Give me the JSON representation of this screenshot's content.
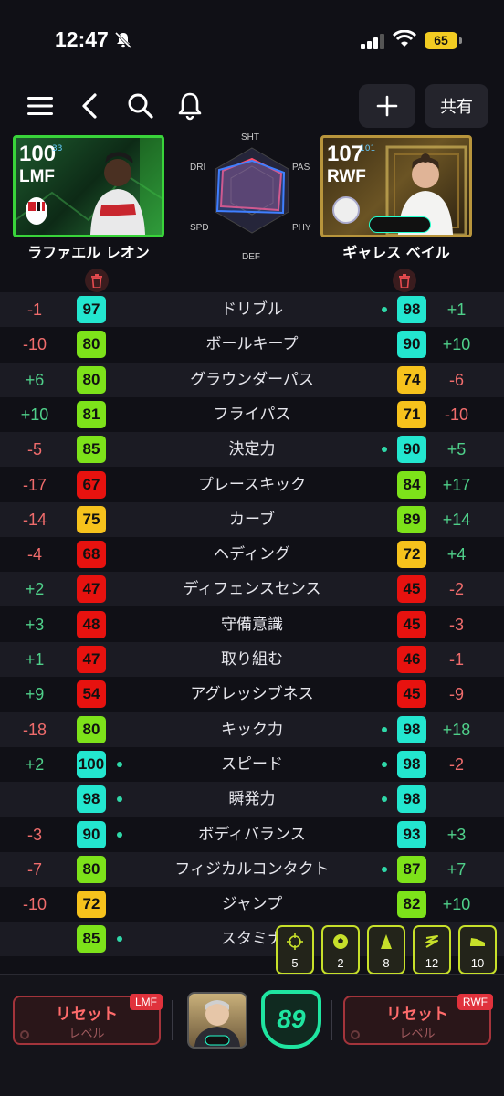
{
  "status_bar": {
    "time": "12:47",
    "battery": "65"
  },
  "toolbar": {
    "share_label": "共有"
  },
  "player_left": {
    "rating": "100",
    "position": "LMF",
    "small_text": "33",
    "name": "ラファエル レオン"
  },
  "player_right": {
    "rating": "107",
    "position": "RWF",
    "small_text": "101",
    "name": "ギャレス ベイル"
  },
  "radar": {
    "labels": [
      "SHT",
      "PAS",
      "PHY",
      "DEF",
      "SPD",
      "DRI"
    ]
  },
  "colors": {
    "cyan": "#23e6cf",
    "green": "#7de21a",
    "yellow": "#f6c21c",
    "red": "#e7120f",
    "diff_pos": "#4fd08a",
    "diff_neg": "#f06c6c"
  },
  "stats": [
    {
      "name": "ドリブル",
      "left_diff": "-1",
      "left": "97",
      "left_color": "cyan",
      "left_dot": false,
      "right": "98",
      "right_color": "cyan",
      "right_dot": true,
      "right_diff": "+1"
    },
    {
      "name": "ボールキープ",
      "left_diff": "-10",
      "left": "80",
      "left_color": "green",
      "left_dot": false,
      "right": "90",
      "right_color": "cyan",
      "right_dot": false,
      "right_diff": "+10"
    },
    {
      "name": "グラウンダーパス",
      "left_diff": "+6",
      "left": "80",
      "left_color": "green",
      "left_dot": false,
      "right": "74",
      "right_color": "yellow",
      "right_dot": false,
      "right_diff": "-6"
    },
    {
      "name": "フライパス",
      "left_diff": "+10",
      "left": "81",
      "left_color": "green",
      "left_dot": false,
      "right": "71",
      "right_color": "yellow",
      "right_dot": false,
      "right_diff": "-10"
    },
    {
      "name": "決定力",
      "left_diff": "-5",
      "left": "85",
      "left_color": "green",
      "left_dot": false,
      "right": "90",
      "right_color": "cyan",
      "right_dot": true,
      "right_diff": "+5"
    },
    {
      "name": "プレースキック",
      "left_diff": "-17",
      "left": "67",
      "left_color": "red",
      "left_dot": false,
      "right": "84",
      "right_color": "green",
      "right_dot": false,
      "right_diff": "+17"
    },
    {
      "name": "カーブ",
      "left_diff": "-14",
      "left": "75",
      "left_color": "yellow",
      "left_dot": false,
      "right": "89",
      "right_color": "green",
      "right_dot": false,
      "right_diff": "+14"
    },
    {
      "name": "ヘディング",
      "left_diff": "-4",
      "left": "68",
      "left_color": "red",
      "left_dot": false,
      "right": "72",
      "right_color": "yellow",
      "right_dot": false,
      "right_diff": "+4"
    },
    {
      "name": "ディフェンスセンス",
      "left_diff": "+2",
      "left": "47",
      "left_color": "red",
      "left_dot": false,
      "right": "45",
      "right_color": "red",
      "right_dot": false,
      "right_diff": "-2"
    },
    {
      "name": "守備意識",
      "left_diff": "+3",
      "left": "48",
      "left_color": "red",
      "left_dot": false,
      "right": "45",
      "right_color": "red",
      "right_dot": false,
      "right_diff": "-3"
    },
    {
      "name": "取り組む",
      "left_diff": "+1",
      "left": "47",
      "left_color": "red",
      "left_dot": false,
      "right": "46",
      "right_color": "red",
      "right_dot": false,
      "right_diff": "-1"
    },
    {
      "name": "アグレッシブネス",
      "left_diff": "+9",
      "left": "54",
      "left_color": "red",
      "left_dot": false,
      "right": "45",
      "right_color": "red",
      "right_dot": false,
      "right_diff": "-9"
    },
    {
      "name": "キック力",
      "left_diff": "-18",
      "left": "80",
      "left_color": "green",
      "left_dot": false,
      "right": "98",
      "right_color": "cyan",
      "right_dot": true,
      "right_diff": "+18"
    },
    {
      "name": "スピード",
      "left_diff": "+2",
      "left": "100",
      "left_color": "cyan",
      "left_dot": true,
      "right": "98",
      "right_color": "cyan",
      "right_dot": true,
      "right_diff": "-2"
    },
    {
      "name": "瞬発力",
      "left_diff": "",
      "left": "98",
      "left_color": "cyan",
      "left_dot": true,
      "right": "98",
      "right_color": "cyan",
      "right_dot": true,
      "right_diff": ""
    },
    {
      "name": "ボディバランス",
      "left_diff": "-3",
      "left": "90",
      "left_color": "cyan",
      "left_dot": true,
      "right": "93",
      "right_color": "cyan",
      "right_dot": false,
      "right_diff": "+3"
    },
    {
      "name": "フィジカルコンタクト",
      "left_diff": "-7",
      "left": "80",
      "left_color": "green",
      "left_dot": false,
      "right": "87",
      "right_color": "green",
      "right_dot": true,
      "right_diff": "+7"
    },
    {
      "name": "ジャンプ",
      "left_diff": "-10",
      "left": "72",
      "left_color": "yellow",
      "left_dot": false,
      "right": "82",
      "right_color": "green",
      "right_dot": false,
      "right_diff": "+10"
    },
    {
      "name": "スタミナ",
      "left_diff": "",
      "left": "85",
      "left_color": "green",
      "left_dot": true,
      "right": "",
      "right_color": "cyan",
      "right_dot": false,
      "right_diff": ""
    }
  ],
  "skills": [
    {
      "icon": "crosshair-icon",
      "count": "5"
    },
    {
      "icon": "football-icon",
      "count": "2"
    },
    {
      "icon": "cone-icon",
      "count": "8"
    },
    {
      "icon": "swerve-icon",
      "count": "12"
    },
    {
      "icon": "boot-icon",
      "count": "10"
    }
  ],
  "bottom": {
    "reset_title": "リセット",
    "reset_sub": "レベル",
    "left_tag": "LMF",
    "right_tag": "RWF",
    "team_rating": "89"
  }
}
